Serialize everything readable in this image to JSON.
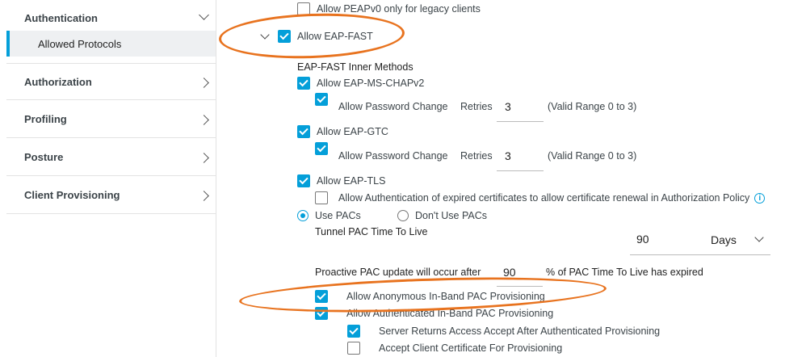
{
  "sidebar": {
    "authentication": "Authentication",
    "allowed_protocols": "Allowed Protocols",
    "authorization": "Authorization",
    "profiling": "Profiling",
    "posture": "Posture",
    "client_provisioning": "Client Provisioning"
  },
  "main": {
    "peapv0": {
      "label": "Allow PEAPv0 only for legacy clients",
      "checked": false
    },
    "eap_fast": {
      "label": "Allow EAP-FAST",
      "checked": true
    },
    "inner_methods_title": "EAP-FAST Inner Methods",
    "ms_chapv2": {
      "label": "Allow EAP-MS-CHAPv2",
      "checked": true
    },
    "ms_pw_change": {
      "label": "Allow Password Change",
      "retries_label": "Retries",
      "retries_value": "3",
      "range": "(Valid Range 0 to 3)"
    },
    "gtc": {
      "label": "Allow EAP-GTC",
      "checked": true
    },
    "gtc_pw_change": {
      "label": "Allow Password Change",
      "retries_label": "Retries",
      "retries_value": "3",
      "range": "(Valid Range 0 to 3)"
    },
    "tls": {
      "label": "Allow EAP-TLS",
      "checked": true
    },
    "expired_certs": {
      "label": "Allow Authentication of expired certificates to allow certificate renewal in Authorization Policy",
      "checked": false
    },
    "use_pacs": "Use PACs",
    "dont_use_pacs": "Don't Use PACs",
    "tunnel_pac_ttl_label": "Tunnel PAC Time To Live",
    "tunnel_pac_ttl_value": "90",
    "tunnel_pac_ttl_unit": "Days",
    "proactive_label": "Proactive PAC update will occur after",
    "proactive_value": "90",
    "proactive_suffix": "% of PAC Time To Live has expired",
    "anon_inband": {
      "label": "Allow Anonymous In-Band PAC Provisioning",
      "checked": true
    },
    "auth_inband": {
      "label": "Allow Authenticated In-Band PAC Provisioning",
      "checked": true
    },
    "server_returns": {
      "label": "Server Returns Access Accept After Authenticated Provisioning",
      "checked": true
    },
    "accept_client_cert": {
      "label": "Accept Client Certificate For Provisioning",
      "checked": false
    }
  },
  "colors": {
    "accent": "#049fd9",
    "annotation": "#e8731f"
  },
  "icons": [
    "chevron-down-icon",
    "chevron-right-icon",
    "checkbox-icon",
    "info-icon"
  ]
}
